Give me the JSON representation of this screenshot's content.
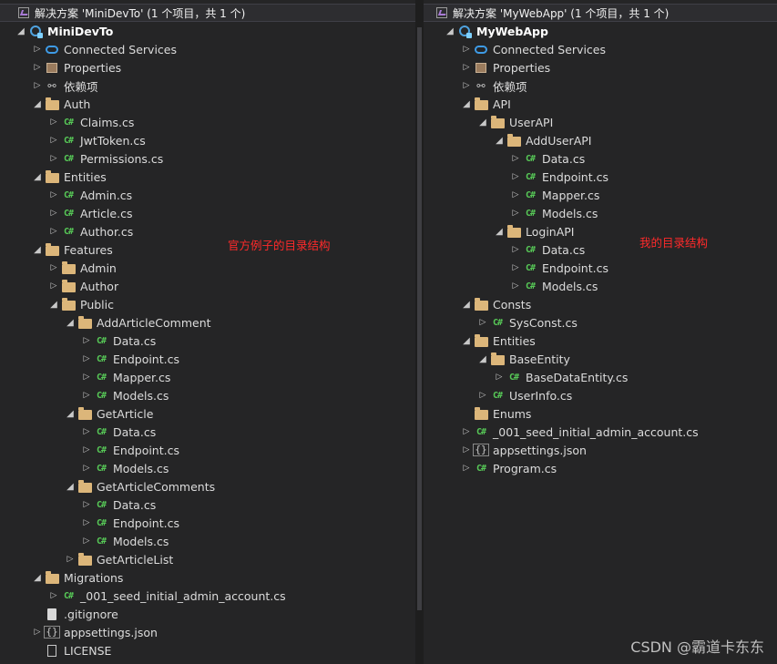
{
  "left": {
    "header": "解决方案 'MiniDevTo' (1 个项目，共 1 个)",
    "items": [
      {
        "label": "MiniDevTo",
        "depth": 0,
        "icon": "project",
        "arrow": "open",
        "bold": true
      },
      {
        "label": "Connected Services",
        "depth": 1,
        "icon": "cloud",
        "arrow": "closed"
      },
      {
        "label": "Properties",
        "depth": 1,
        "icon": "wrench",
        "arrow": "closed"
      },
      {
        "label": "依赖项",
        "depth": 1,
        "icon": "deps",
        "arrow": "closed"
      },
      {
        "label": "Auth",
        "depth": 1,
        "icon": "folder",
        "arrow": "open"
      },
      {
        "label": "Claims.cs",
        "depth": 2,
        "icon": "cs",
        "arrow": "closed"
      },
      {
        "label": "JwtToken.cs",
        "depth": 2,
        "icon": "cs",
        "arrow": "closed"
      },
      {
        "label": "Permissions.cs",
        "depth": 2,
        "icon": "cs",
        "arrow": "closed"
      },
      {
        "label": "Entities",
        "depth": 1,
        "icon": "folder",
        "arrow": "open"
      },
      {
        "label": "Admin.cs",
        "depth": 2,
        "icon": "cs",
        "arrow": "closed"
      },
      {
        "label": "Article.cs",
        "depth": 2,
        "icon": "cs",
        "arrow": "closed"
      },
      {
        "label": "Author.cs",
        "depth": 2,
        "icon": "cs",
        "arrow": "closed"
      },
      {
        "label": "Features",
        "depth": 1,
        "icon": "folder",
        "arrow": "open"
      },
      {
        "label": "Admin",
        "depth": 2,
        "icon": "folder",
        "arrow": "closed"
      },
      {
        "label": "Author",
        "depth": 2,
        "icon": "folder",
        "arrow": "closed"
      },
      {
        "label": "Public",
        "depth": 2,
        "icon": "folder",
        "arrow": "open"
      },
      {
        "label": "AddArticleComment",
        "depth": 3,
        "icon": "folder",
        "arrow": "open"
      },
      {
        "label": "Data.cs",
        "depth": 4,
        "icon": "cs",
        "arrow": "closed"
      },
      {
        "label": "Endpoint.cs",
        "depth": 4,
        "icon": "cs",
        "arrow": "closed"
      },
      {
        "label": "Mapper.cs",
        "depth": 4,
        "icon": "cs",
        "arrow": "closed"
      },
      {
        "label": "Models.cs",
        "depth": 4,
        "icon": "cs",
        "arrow": "closed"
      },
      {
        "label": "GetArticle",
        "depth": 3,
        "icon": "folder",
        "arrow": "open"
      },
      {
        "label": "Data.cs",
        "depth": 4,
        "icon": "cs",
        "arrow": "closed"
      },
      {
        "label": "Endpoint.cs",
        "depth": 4,
        "icon": "cs",
        "arrow": "closed"
      },
      {
        "label": "Models.cs",
        "depth": 4,
        "icon": "cs",
        "arrow": "closed"
      },
      {
        "label": "GetArticleComments",
        "depth": 3,
        "icon": "folder",
        "arrow": "open"
      },
      {
        "label": "Data.cs",
        "depth": 4,
        "icon": "cs",
        "arrow": "closed"
      },
      {
        "label": "Endpoint.cs",
        "depth": 4,
        "icon": "cs",
        "arrow": "closed"
      },
      {
        "label": "Models.cs",
        "depth": 4,
        "icon": "cs",
        "arrow": "closed"
      },
      {
        "label": "GetArticleList",
        "depth": 3,
        "icon": "folder",
        "arrow": "closed"
      },
      {
        "label": "Migrations",
        "depth": 1,
        "icon": "folder",
        "arrow": "open"
      },
      {
        "label": "_001_seed_initial_admin_account.cs",
        "depth": 2,
        "icon": "cs",
        "arrow": "closed"
      },
      {
        "label": ".gitignore",
        "depth": 1,
        "icon": "file",
        "arrow": "none"
      },
      {
        "label": "appsettings.json",
        "depth": 1,
        "icon": "json",
        "arrow": "closed"
      },
      {
        "label": "LICENSE",
        "depth": 1,
        "icon": "doc",
        "arrow": "none"
      }
    ],
    "annotation": "官方例子的目录结构"
  },
  "right": {
    "header": "解决方案 'MyWebApp' (1 个项目，共 1 个)",
    "items": [
      {
        "label": "MyWebApp",
        "depth": 0,
        "icon": "project",
        "arrow": "open",
        "bold": true
      },
      {
        "label": "Connected Services",
        "depth": 1,
        "icon": "cloud",
        "arrow": "closed"
      },
      {
        "label": "Properties",
        "depth": 1,
        "icon": "wrench",
        "arrow": "closed"
      },
      {
        "label": "依赖项",
        "depth": 1,
        "icon": "deps",
        "arrow": "closed"
      },
      {
        "label": "API",
        "depth": 1,
        "icon": "folder",
        "arrow": "open"
      },
      {
        "label": "UserAPI",
        "depth": 2,
        "icon": "folder",
        "arrow": "open"
      },
      {
        "label": "AddUserAPI",
        "depth": 3,
        "icon": "folder",
        "arrow": "open"
      },
      {
        "label": "Data.cs",
        "depth": 4,
        "icon": "cs",
        "arrow": "closed"
      },
      {
        "label": "Endpoint.cs",
        "depth": 4,
        "icon": "cs",
        "arrow": "closed"
      },
      {
        "label": "Mapper.cs",
        "depth": 4,
        "icon": "cs",
        "arrow": "closed"
      },
      {
        "label": "Models.cs",
        "depth": 4,
        "icon": "cs",
        "arrow": "closed"
      },
      {
        "label": "LoginAPI",
        "depth": 3,
        "icon": "folder",
        "arrow": "open"
      },
      {
        "label": "Data.cs",
        "depth": 4,
        "icon": "cs",
        "arrow": "closed"
      },
      {
        "label": "Endpoint.cs",
        "depth": 4,
        "icon": "cs",
        "arrow": "closed"
      },
      {
        "label": "Models.cs",
        "depth": 4,
        "icon": "cs",
        "arrow": "closed"
      },
      {
        "label": "Consts",
        "depth": 1,
        "icon": "folder",
        "arrow": "open"
      },
      {
        "label": "SysConst.cs",
        "depth": 2,
        "icon": "cs",
        "arrow": "closed"
      },
      {
        "label": "Entities",
        "depth": 1,
        "icon": "folder",
        "arrow": "open"
      },
      {
        "label": "BaseEntity",
        "depth": 2,
        "icon": "folder",
        "arrow": "open"
      },
      {
        "label": "BaseDataEntity.cs",
        "depth": 3,
        "icon": "cs",
        "arrow": "closed"
      },
      {
        "label": "UserInfo.cs",
        "depth": 2,
        "icon": "cs",
        "arrow": "closed"
      },
      {
        "label": "Enums",
        "depth": 1,
        "icon": "folder",
        "arrow": "none"
      },
      {
        "label": "_001_seed_initial_admin_account.cs",
        "depth": 1,
        "icon": "cs",
        "arrow": "closed"
      },
      {
        "label": "appsettings.json",
        "depth": 1,
        "icon": "json",
        "arrow": "closed"
      },
      {
        "label": "Program.cs",
        "depth": 1,
        "icon": "cs",
        "arrow": "closed"
      }
    ],
    "annotation": "我的目录结构"
  },
  "watermark": "CSDN @霸道卡东东",
  "colors": {
    "folder": "#dcb67a",
    "csharp": "#57c957",
    "annotation": "#ff2a2a",
    "background": "#252526"
  }
}
